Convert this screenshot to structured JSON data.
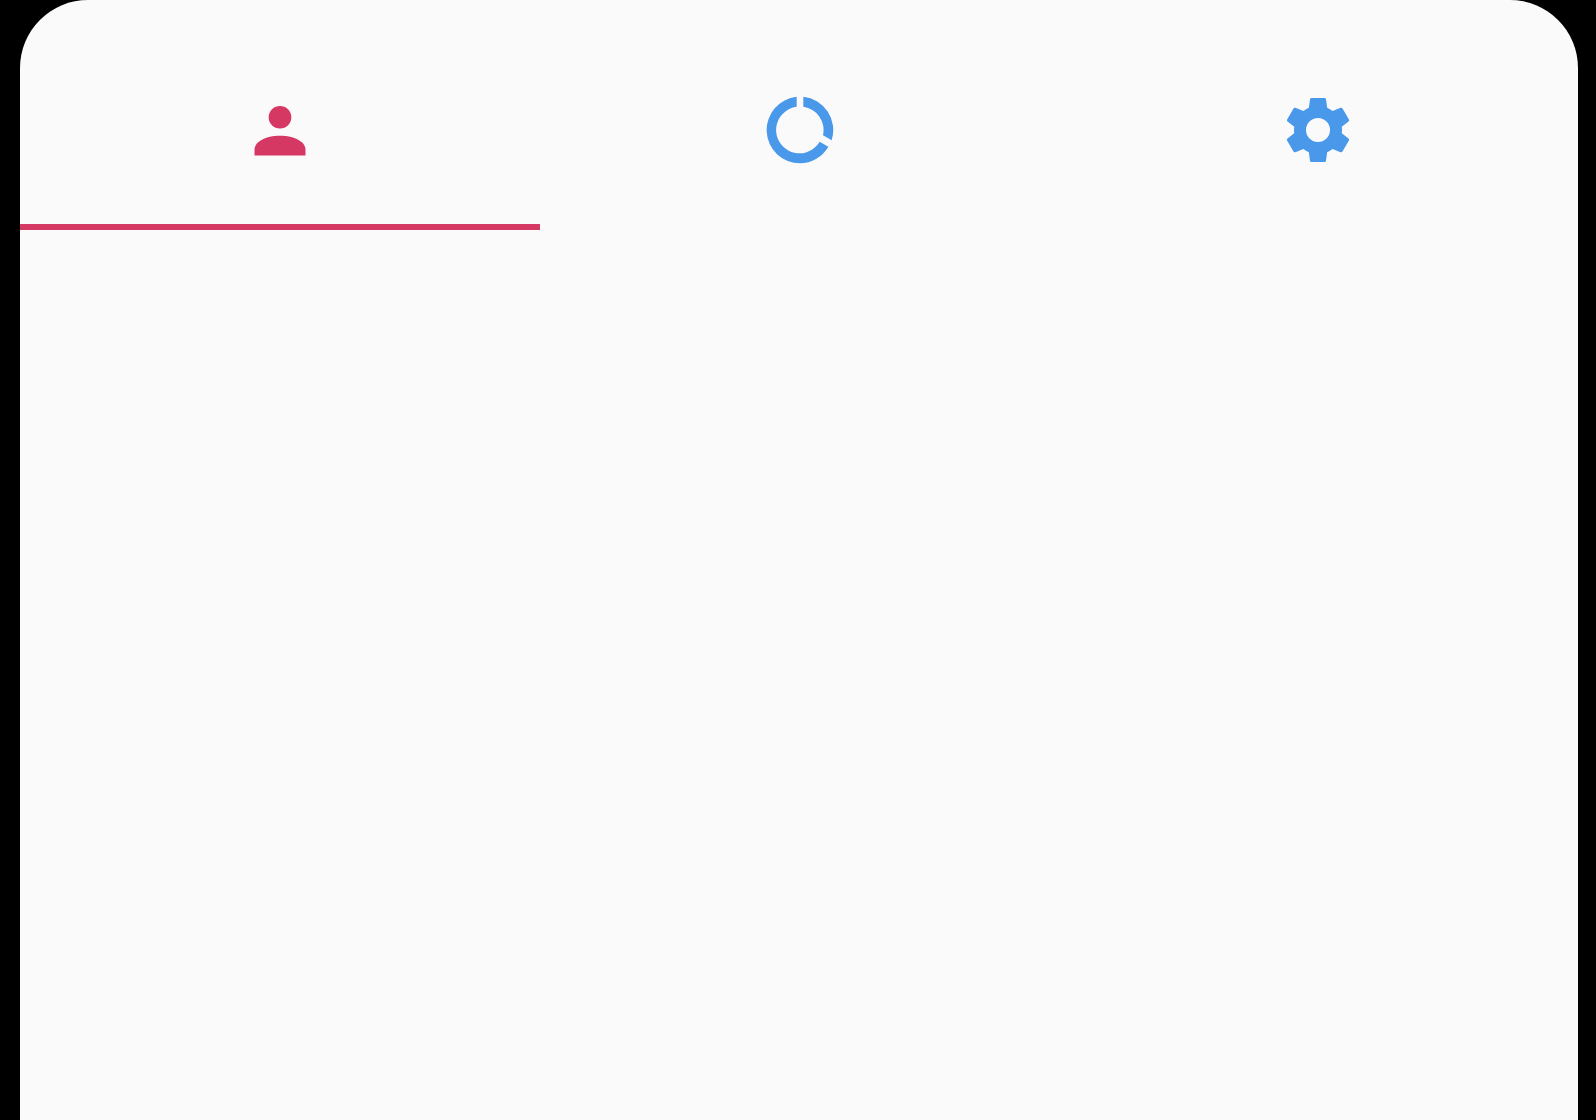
{
  "tabs": [
    {
      "selected": true
    },
    {
      "selected": false
    },
    {
      "selected": false
    }
  ]
}
